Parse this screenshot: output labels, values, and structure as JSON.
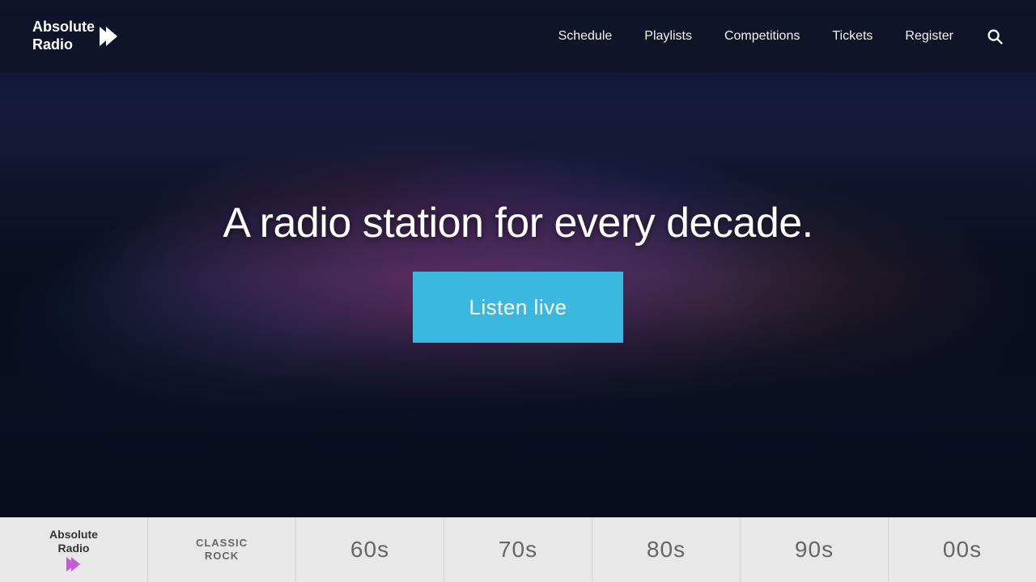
{
  "header": {
    "logo": {
      "line1": "Absolute",
      "line2": "Radio"
    },
    "nav": {
      "items": [
        {
          "id": "schedule",
          "label": "Schedule"
        },
        {
          "id": "playlists",
          "label": "Playlists"
        },
        {
          "id": "competitions",
          "label": "Competitions"
        },
        {
          "id": "tickets",
          "label": "Tickets"
        },
        {
          "id": "register",
          "label": "Register"
        }
      ]
    }
  },
  "hero": {
    "title": "A radio station for every decade.",
    "cta_label": "Listen live"
  },
  "bottom_bar": {
    "channels": [
      {
        "id": "absolute",
        "type": "logo",
        "line1": "Absolute",
        "line2": "Radio"
      },
      {
        "id": "classic-rock",
        "type": "text",
        "label": "CLASSIC ROCK",
        "multiline": true,
        "line1": "CLASSIC",
        "line2": "ROCK"
      },
      {
        "id": "60s",
        "type": "decade",
        "label": "60s"
      },
      {
        "id": "70s",
        "type": "decade",
        "label": "70s"
      },
      {
        "id": "80s",
        "type": "decade",
        "label": "80s"
      },
      {
        "id": "90s",
        "type": "decade",
        "label": "90s"
      },
      {
        "id": "00s",
        "type": "decade",
        "label": "00s"
      }
    ]
  }
}
